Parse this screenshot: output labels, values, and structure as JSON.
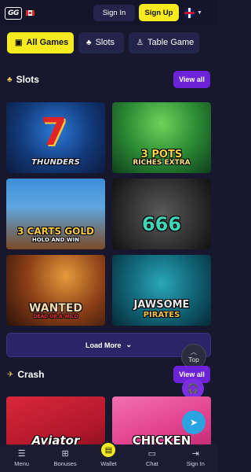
{
  "header": {
    "logo_text": "GG",
    "signin_label": "Sign In",
    "signup_label": "Sign Up"
  },
  "tabs": [
    {
      "label": "All Games",
      "icon": "cards-icon"
    },
    {
      "label": "Slots",
      "icon": "slots-icon"
    },
    {
      "label": "Table Game",
      "icon": "table-icon"
    }
  ],
  "slots_section": {
    "title": "Slots",
    "view_all_label": "View all",
    "games": [
      {
        "title": "THUNDERS",
        "title_top": "7"
      },
      {
        "title": "3 POTS",
        "subtitle": "RICHES EXTRA"
      },
      {
        "title": "3 CARTS GOLD",
        "subtitle": "HOLD AND WIN"
      },
      {
        "title": "666"
      },
      {
        "title": "WANTED",
        "subtitle": "DEAD OR A WILD"
      },
      {
        "title": "JAWSOME",
        "subtitle": "PIRATES"
      }
    ],
    "load_more_label": "Load More"
  },
  "crash_section": {
    "title": "Crash",
    "view_all_label": "View all",
    "games": [
      {
        "title": "Aviator"
      },
      {
        "title": "CHICKEN"
      }
    ]
  },
  "floating": {
    "top_label": "Top"
  },
  "bottom_nav": [
    {
      "label": "Menu",
      "icon": "menu-icon"
    },
    {
      "label": "Bonuses",
      "icon": "gift-icon"
    },
    {
      "label": "Wallet",
      "icon": "wallet-icon"
    },
    {
      "label": "Chat",
      "icon": "chat-icon"
    },
    {
      "label": "Sign In",
      "icon": "signin-icon"
    }
  ],
  "colors": {
    "background": "#17182e",
    "accent_yellow": "#f7ea1f",
    "accent_purple": "#6c22d6",
    "tab_bg": "#23244a"
  }
}
